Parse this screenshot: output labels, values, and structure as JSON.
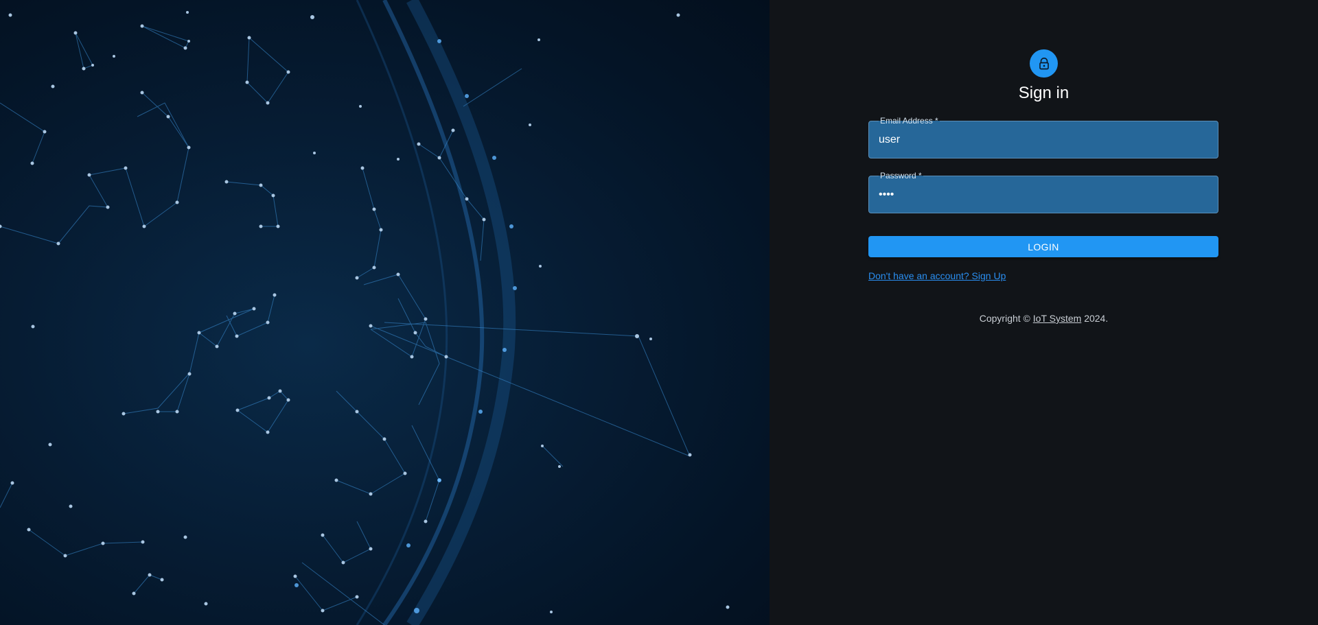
{
  "colors": {
    "accent": "#2196f3",
    "field_bg": "#266799",
    "panel_bg": "#111418",
    "hero_bg": "#061c33"
  },
  "auth": {
    "icon": "lock-icon",
    "title": "Sign in",
    "email": {
      "label": "Email Address *",
      "value": "user"
    },
    "password": {
      "label": "Password *",
      "value": "••••"
    },
    "login_label": "LOGIN",
    "signup_link": "Don't have an account? Sign Up"
  },
  "footer": {
    "copyright_prefix": "Copyright ©",
    "brand": "IoT System",
    "year_suffix": "2024."
  }
}
